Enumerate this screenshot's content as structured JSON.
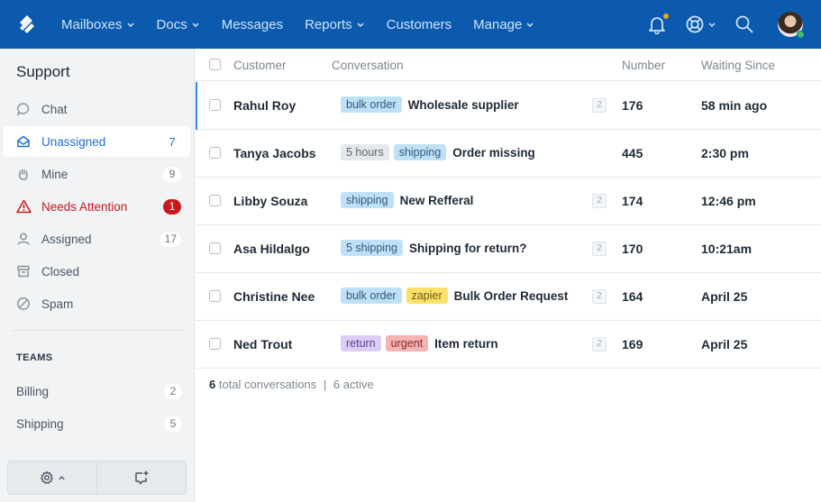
{
  "topbar": {
    "nav": [
      {
        "label": "Mailboxes",
        "dropdown": true
      },
      {
        "label": "Docs",
        "dropdown": true
      },
      {
        "label": "Messages",
        "dropdown": false
      },
      {
        "label": "Reports",
        "dropdown": true
      },
      {
        "label": "Customers",
        "dropdown": false
      },
      {
        "label": "Manage",
        "dropdown": true
      }
    ],
    "icons": [
      "bell-icon",
      "help-lifebuoy-icon",
      "search-icon",
      "avatar"
    ],
    "colors": {
      "brand": "#0b5aad",
      "notification_dot": "#f5a623",
      "online": "#3cbf6a"
    }
  },
  "sidebar": {
    "title": "Support",
    "items": [
      {
        "label": "Chat",
        "icon": "chat-bubble-icon",
        "count": null
      },
      {
        "label": "Unassigned",
        "icon": "envelope-open-icon",
        "count": "7",
        "active": true
      },
      {
        "label": "Mine",
        "icon": "hand-icon",
        "count": "9"
      },
      {
        "label": "Needs Attention",
        "icon": "warning-icon",
        "count": "1",
        "alert": true
      },
      {
        "label": "Assigned",
        "icon": "user-icon",
        "count": "17"
      },
      {
        "label": "Closed",
        "icon": "archive-icon",
        "count": null
      },
      {
        "label": "Spam",
        "icon": "block-icon",
        "count": null
      }
    ],
    "teams_heading": "TEAMS",
    "teams": [
      {
        "label": "Billing",
        "count": "2"
      },
      {
        "label": "Shipping",
        "count": "5"
      }
    ],
    "footer": [
      "settings-gear-icon",
      "new-chat-icon"
    ]
  },
  "table": {
    "headers": {
      "customer": "Customer",
      "conversation": "Conversation",
      "number": "Number",
      "waiting": "Waiting Since"
    },
    "rows": [
      {
        "customer": "Rahul Roy",
        "tags": [
          {
            "text": "bulk order",
            "bg": "#bfe1f7",
            "fg": "#2c5a7a"
          }
        ],
        "subject": "Wholesale supplier",
        "threads": "2",
        "number": "176",
        "waiting": "58 min ago",
        "selected": true
      },
      {
        "customer": "Tanya Jacobs",
        "tags": [
          {
            "text": "5 hours",
            "bg": "#e5e8eb",
            "fg": "#5b6570"
          },
          {
            "text": "shipping",
            "bg": "#bfe1f7",
            "fg": "#2c5a7a"
          }
        ],
        "subject": "Order missing",
        "threads": null,
        "number": "445",
        "waiting": "2:30 pm"
      },
      {
        "customer": "Libby Souza",
        "tags": [
          {
            "text": "shipping",
            "bg": "#bfe1f7",
            "fg": "#2c5a7a"
          }
        ],
        "subject": "New Refferal",
        "threads": "2",
        "number": "174",
        "waiting": "12:46 pm"
      },
      {
        "customer": "Asa Hildalgo",
        "tags": [
          {
            "text": "5 shipping",
            "bg": "#bfe1f7",
            "fg": "#2c5a7a"
          }
        ],
        "subject": "Shipping for return?",
        "threads": "2",
        "number": "170",
        "waiting": "10:21am"
      },
      {
        "customer": "Christine Nee",
        "tags": [
          {
            "text": "bulk order",
            "bg": "#bfe1f7",
            "fg": "#2c5a7a"
          },
          {
            "text": "zapier",
            "bg": "#fde06b",
            "fg": "#6b5a12"
          }
        ],
        "subject": "Bulk Order Request",
        "threads": "2",
        "number": "164",
        "waiting": "April 25"
      },
      {
        "customer": "Ned Trout",
        "tags": [
          {
            "text": "return",
            "bg": "#dccdf6",
            "fg": "#5b4390"
          },
          {
            "text": "urgent",
            "bg": "#f5b3b3",
            "fg": "#8a2b2b"
          }
        ],
        "subject": "Item return",
        "threads": "2",
        "number": "169",
        "waiting": "April 25"
      }
    ],
    "summary": {
      "total": "6",
      "total_label": "total conversations",
      "separator": "|",
      "active": "6 active"
    }
  }
}
